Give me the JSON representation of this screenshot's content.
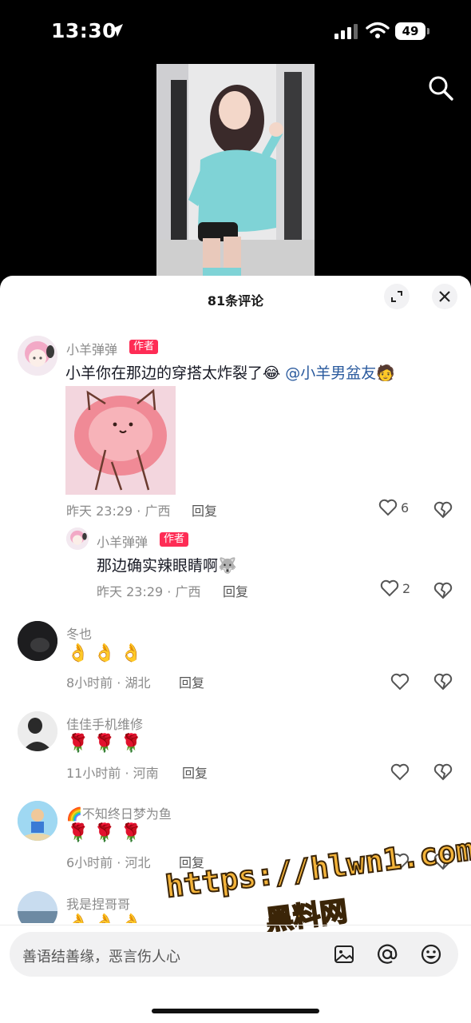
{
  "status": {
    "time": "13:30",
    "battery": "49"
  },
  "sheet": {
    "title": "81条评论"
  },
  "comments": [
    {
      "user": "小羊弹弹",
      "badge": "作者",
      "text": "小羊你在那边的穿搭太炸裂了😂",
      "mention": "@小羊男盆友",
      "mention_emoji": "🧑",
      "meta": "昨天 23:29 · 广西",
      "reply": "回复",
      "likes": "6",
      "replies": [
        {
          "user": "小羊弹弹",
          "badge": "作者",
          "text": "那边确实辣眼睛啊🐺",
          "meta": "昨天 23:29 · 广西",
          "reply": "回复",
          "likes": "2"
        }
      ]
    },
    {
      "user": "冬也",
      "emojis": "👌👌👌",
      "meta": "8小时前 · 湖北",
      "reply": "回复"
    },
    {
      "user": "佳佳手机维修",
      "emojis": "🌹🌹🌹",
      "meta": "11小时前 · 河南",
      "reply": "回复"
    },
    {
      "user": "🌈不知终日梦为鱼",
      "emojis": "🌹🌹🌹",
      "meta": "6小时前 · 河北",
      "reply": "回复"
    },
    {
      "user": "我是捏哥哥",
      "emojis": "👌👌👌"
    }
  ],
  "input": {
    "placeholder": "善语结善缘，恶言伤人心"
  },
  "watermark": {
    "line1": "https://hlwn1.com",
    "line2": "黑料网"
  },
  "colors": {
    "accent": "#fe2c55",
    "mention": "#2b5b9e",
    "watermark": "#f4b43a"
  }
}
